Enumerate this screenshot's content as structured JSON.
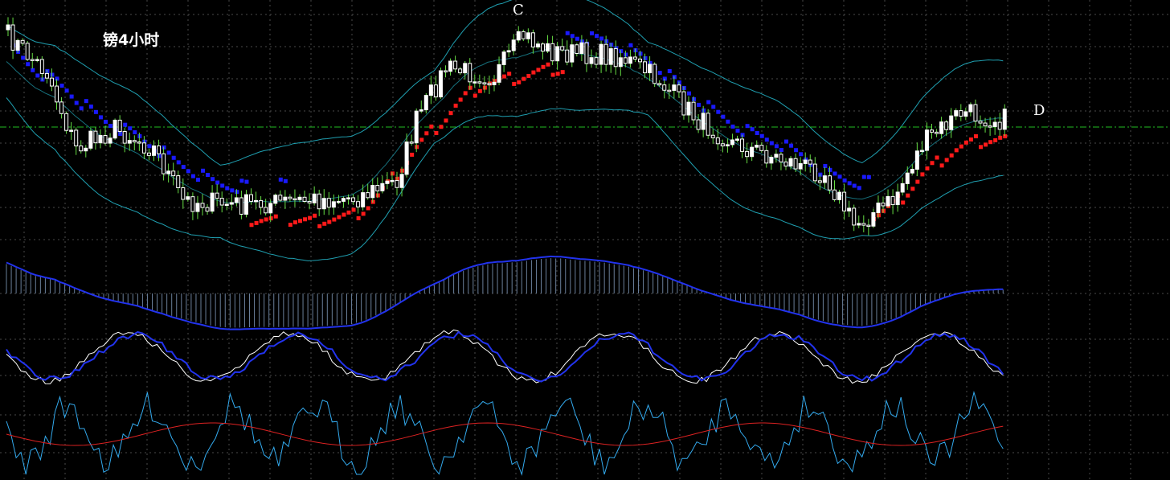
{
  "chart_data": {
    "type": "candlestick",
    "title": "镑4小时",
    "annotations": [
      {
        "text": "C",
        "at_bar": 106
      },
      {
        "text": "D",
        "at_bar": 196
      }
    ],
    "horizontal_line": {
      "style": "dash-dot",
      "color": "#22bb22"
    },
    "grid": true,
    "colors": {
      "background": "#000000",
      "grid": "#4a4a4a",
      "candle": "#ffffff",
      "wick": "#66dd44",
      "bollinger": "#1f9fb0",
      "sar_up": "#ff1a1a",
      "sar_down": "#1a1aff",
      "macd_line": "#2233ee",
      "macd_hist": "#6a7f9a",
      "stoch_k": "#ffffff",
      "stoch_d": "#2233ee",
      "lower_fast": "#33aaee",
      "lower_slow": "#dd2222"
    },
    "series": [
      {
        "name": "price",
        "kind": "ohlc",
        "bars": 206
      },
      {
        "name": "bollinger",
        "kind": "band"
      },
      {
        "name": "parabolic_sar",
        "kind": "dots"
      },
      {
        "name": "macd",
        "kind": "histogram+line"
      },
      {
        "name": "stochastic",
        "kind": "two-lines"
      },
      {
        "name": "oscillator",
        "kind": "two-lines"
      }
    ]
  }
}
